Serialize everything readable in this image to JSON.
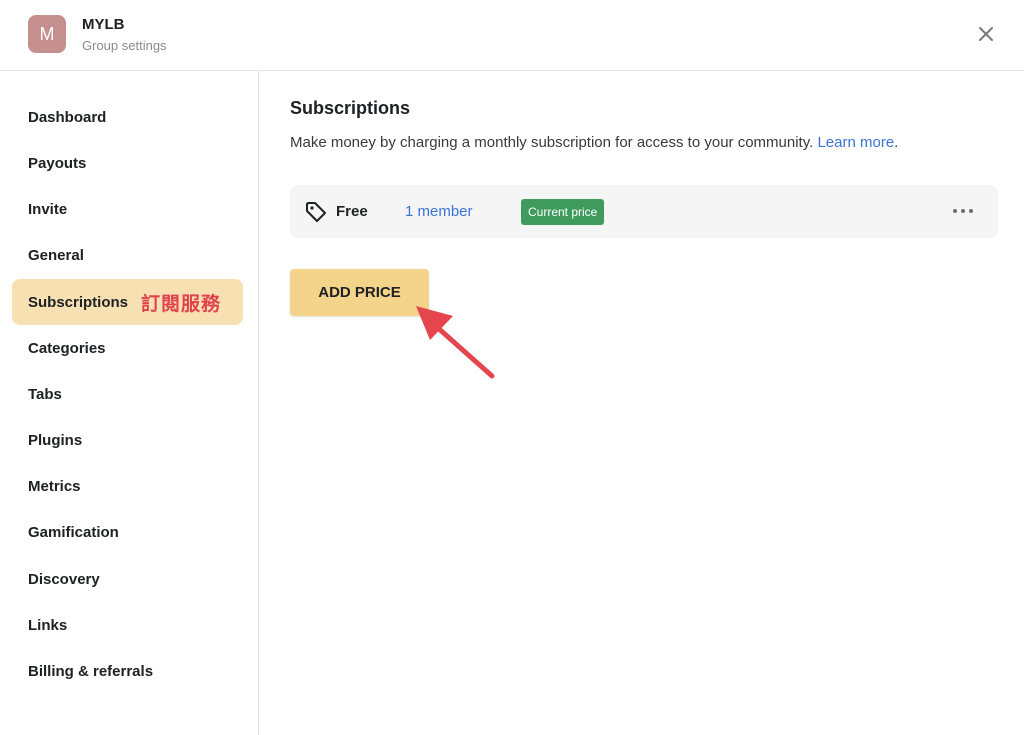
{
  "header": {
    "avatar_letter": "M",
    "group_name": "MYLB",
    "subtitle": "Group settings",
    "close_icon": "close-icon"
  },
  "sidebar": {
    "items": [
      {
        "label": "Dashboard"
      },
      {
        "label": "Payouts"
      },
      {
        "label": "Invite"
      },
      {
        "label": "General"
      },
      {
        "label": "Subscriptions",
        "active": true,
        "annotation": "訂閱服務"
      },
      {
        "label": "Categories"
      },
      {
        "label": "Tabs"
      },
      {
        "label": "Plugins"
      },
      {
        "label": "Metrics"
      },
      {
        "label": "Gamification"
      },
      {
        "label": "Discovery"
      },
      {
        "label": "Links"
      },
      {
        "label": "Billing & referrals"
      }
    ]
  },
  "main": {
    "title": "Subscriptions",
    "description": "Make money by charging a monthly subscription for access to your community.",
    "learn_more": "Learn more",
    "period": ".",
    "price_row": {
      "icon": "tag-icon",
      "name": "Free",
      "members": "1 member",
      "badge": "Current price",
      "more_icon": "more-horizontal-icon"
    },
    "add_price_label": "ADD PRICE"
  },
  "colors": {
    "accent_yellow": "#f3d48a",
    "active_nav": "#f7e1b3",
    "link_blue": "#3b73d6",
    "badge_green": "#3e9b5c",
    "annotation_red": "#e0434f",
    "avatar": "#c58f8d"
  }
}
